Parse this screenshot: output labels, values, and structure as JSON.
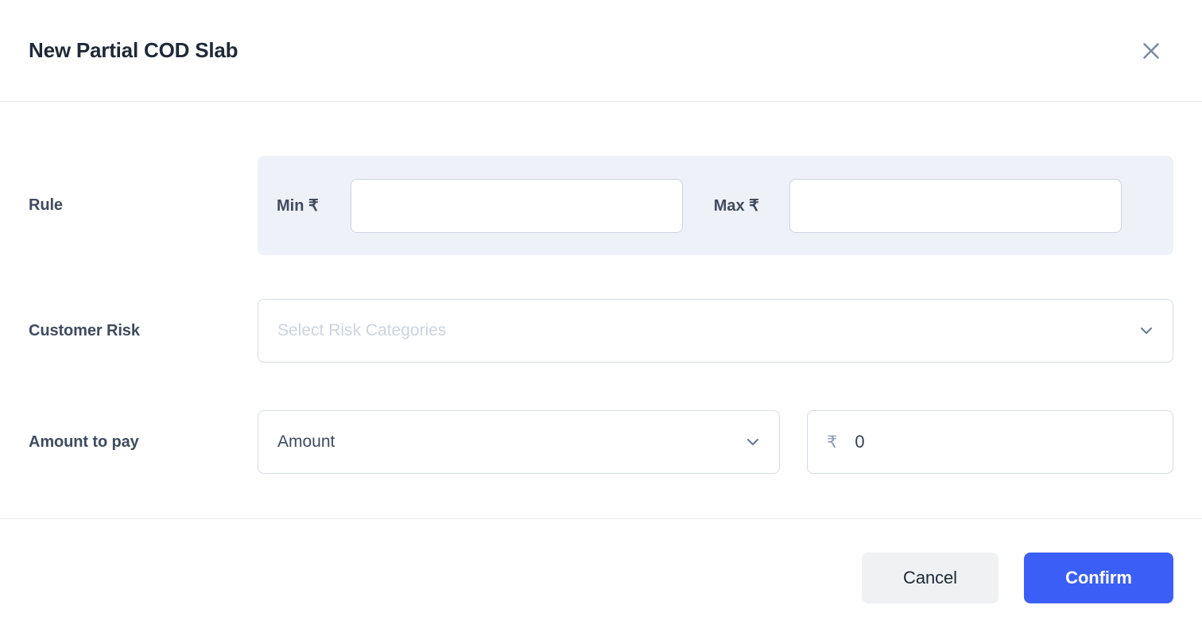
{
  "modal": {
    "title": "New Partial COD Slab",
    "close_icon": "close-icon"
  },
  "form": {
    "rule": {
      "label": "Rule",
      "min_label": "Min ₹",
      "min_value": "",
      "min_placeholder": "",
      "max_label": "Max ₹",
      "max_value": "",
      "max_placeholder": ""
    },
    "customer_risk": {
      "label": "Customer Risk",
      "placeholder": "Select Risk Categories",
      "value": "",
      "chevron_icon": "chevron-down-icon"
    },
    "amount_to_pay": {
      "label": "Amount to pay",
      "type_value": "Amount",
      "chevron_icon": "chevron-down-icon",
      "currency_symbol": "₹",
      "amount_value": "0"
    }
  },
  "footer": {
    "cancel_label": "Cancel",
    "confirm_label": "Confirm"
  },
  "colors": {
    "accent": "#3b5ff6",
    "rule_group_bg": "#eef1f7",
    "label_text": "#3f4b5e",
    "placeholder": "#ccd4e0",
    "border": "#d4dbe6",
    "cancel_bg": "#f0f1f3"
  }
}
